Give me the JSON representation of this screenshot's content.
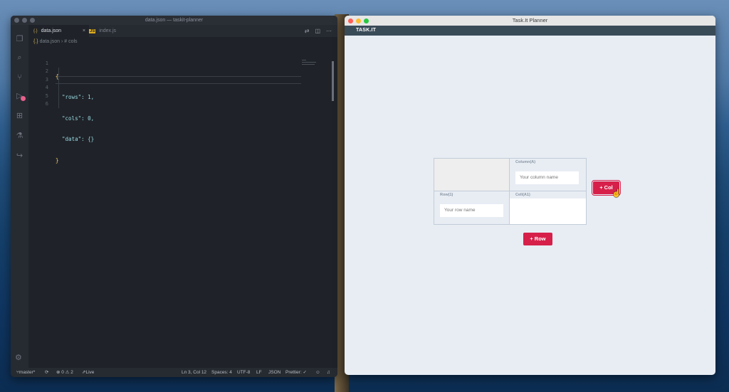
{
  "vscode": {
    "window_title": "data.json — taskit-planner",
    "tabs": [
      {
        "icon": "{.}",
        "label": "data.json",
        "close": "×"
      },
      {
        "icon": "JS",
        "label": "index.js"
      }
    ],
    "breadcrumb": {
      "file": "data.json",
      "sep": "›",
      "symbol": "cols",
      "symbol_icon": "#"
    },
    "line_numbers": [
      "1",
      "2",
      "3",
      "4",
      "5",
      "6"
    ],
    "code_lines": [
      "{",
      "  \"rows\": 1,",
      "  \"cols\": 0,",
      "  \"data\": {}",
      "}",
      ""
    ],
    "status": {
      "branch": "master*",
      "sync": "⟳",
      "problems": "⊗ 0 ⚠ 2",
      "live_share": "Live Share",
      "position": "Ln 3, Col 12",
      "spaces": "Spaces: 4",
      "encoding": "UTF-8",
      "eol": "LF",
      "language": "JSON",
      "prettier": "Prettier: ✓"
    }
  },
  "taskit": {
    "window_title": "Task.It Planner",
    "brand": "TASK.IT",
    "column_label": "Column(A)",
    "column_placeholder": "Your column name",
    "row_label": "Row(1)",
    "row_placeholder": "Your row name",
    "cell_label": "Cell(A1)",
    "add_col": "+ Col",
    "add_row": "+ Row"
  },
  "colors": {
    "accent": "#d6204a",
    "nav": "#3a4b58",
    "editor_bg": "#1f2329"
  }
}
